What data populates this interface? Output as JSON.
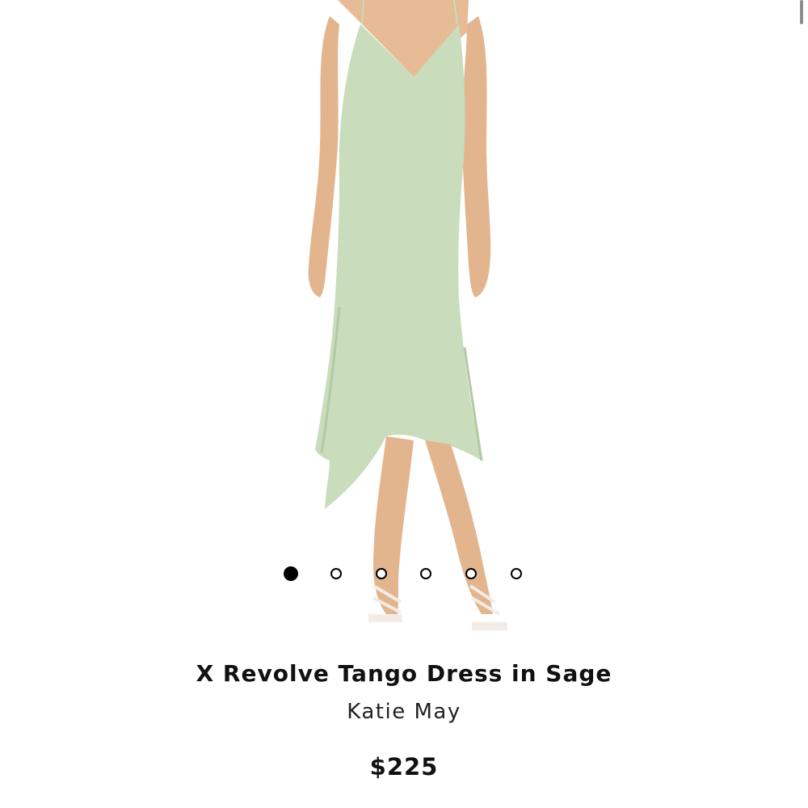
{
  "product": {
    "title": "X Revolve Tango Dress in Sage",
    "brand": "Katie May",
    "price": "$225",
    "color_sage": "#c9dcbc"
  },
  "gallery": {
    "image_icon": "product-photo",
    "slide_count": 6,
    "active_slide": 1
  }
}
